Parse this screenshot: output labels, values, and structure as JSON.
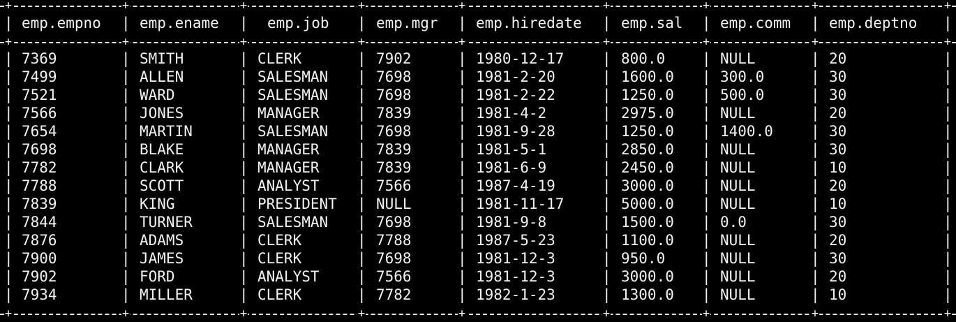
{
  "table": {
    "columns": [
      "emp.empno",
      "emp.ename",
      "emp.job",
      "emp.mgr",
      "emp.hiredate",
      "emp.sal",
      "emp.comm",
      "emp.deptno"
    ],
    "rows": [
      [
        "7369",
        "SMITH",
        "CLERK",
        "7902",
        "1980-12-17",
        "800.0",
        "NULL",
        "20"
      ],
      [
        "7499",
        "ALLEN",
        "SALESMAN",
        "7698",
        "1981-2-20",
        "1600.0",
        "300.0",
        "30"
      ],
      [
        "7521",
        "WARD",
        "SALESMAN",
        "7698",
        "1981-2-22",
        "1250.0",
        "500.0",
        "30"
      ],
      [
        "7566",
        "JONES",
        "MANAGER",
        "7839",
        "1981-4-2",
        "2975.0",
        "NULL",
        "20"
      ],
      [
        "7654",
        "MARTIN",
        "SALESMAN",
        "7698",
        "1981-9-28",
        "1250.0",
        "1400.0",
        "30"
      ],
      [
        "7698",
        "BLAKE",
        "MANAGER",
        "7839",
        "1981-5-1",
        "2850.0",
        "NULL",
        "30"
      ],
      [
        "7782",
        "CLARK",
        "MANAGER",
        "7839",
        "1981-6-9",
        "2450.0",
        "NULL",
        "10"
      ],
      [
        "7788",
        "SCOTT",
        "ANALYST",
        "7566",
        "1987-4-19",
        "3000.0",
        "NULL",
        "20"
      ],
      [
        "7839",
        "KING",
        "PRESIDENT",
        "NULL",
        "1981-11-17",
        "5000.0",
        "NULL",
        "10"
      ],
      [
        "7844",
        "TURNER",
        "SALESMAN",
        "7698",
        "1981-9-8",
        "1500.0",
        "0.0",
        "30"
      ],
      [
        "7876",
        "ADAMS",
        "CLERK",
        "7788",
        "1987-5-23",
        "1100.0",
        "NULL",
        "20"
      ],
      [
        "7900",
        "JAMES",
        "CLERK",
        "7698",
        "1981-12-3",
        "950.0",
        "NULL",
        "30"
      ],
      [
        "7902",
        "FORD",
        "ANALYST",
        "7566",
        "1981-12-3",
        "3000.0",
        "NULL",
        "20"
      ],
      [
        "7934",
        "MILLER",
        "CLERK",
        "7782",
        "1982-1-23",
        "1300.0",
        "NULL",
        "10"
      ]
    ]
  }
}
